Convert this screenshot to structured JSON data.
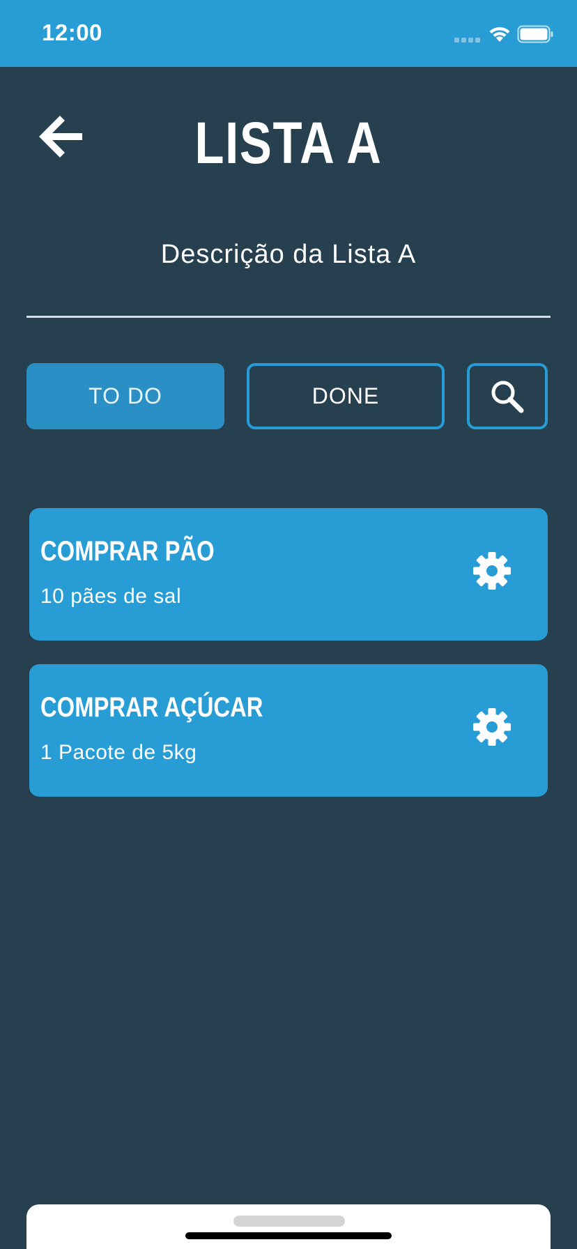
{
  "status_bar": {
    "time": "12:00",
    "icons": [
      "signal-icon",
      "wifi-icon",
      "battery-icon"
    ]
  },
  "header": {
    "back_icon": "back-arrow-icon",
    "title": "LISTA A",
    "description": "Descrição da Lista A"
  },
  "filters": {
    "todo_label": "TO DO",
    "done_label": "DONE",
    "search_icon": "search-icon",
    "selected": "TO DO"
  },
  "tasks": [
    {
      "title": "COMPRAR PÃO",
      "subtitle": "10 pães de sal",
      "settings_icon": "gear-icon"
    },
    {
      "title": "COMPRAR AÇÚCAR",
      "subtitle": "1 Pacote de 5kg",
      "settings_icon": "gear-icon"
    }
  ],
  "colors": {
    "background": "#27404f",
    "accent": "#289dd5",
    "selected_button": "#2a8fc4",
    "text": "#ffffff"
  }
}
